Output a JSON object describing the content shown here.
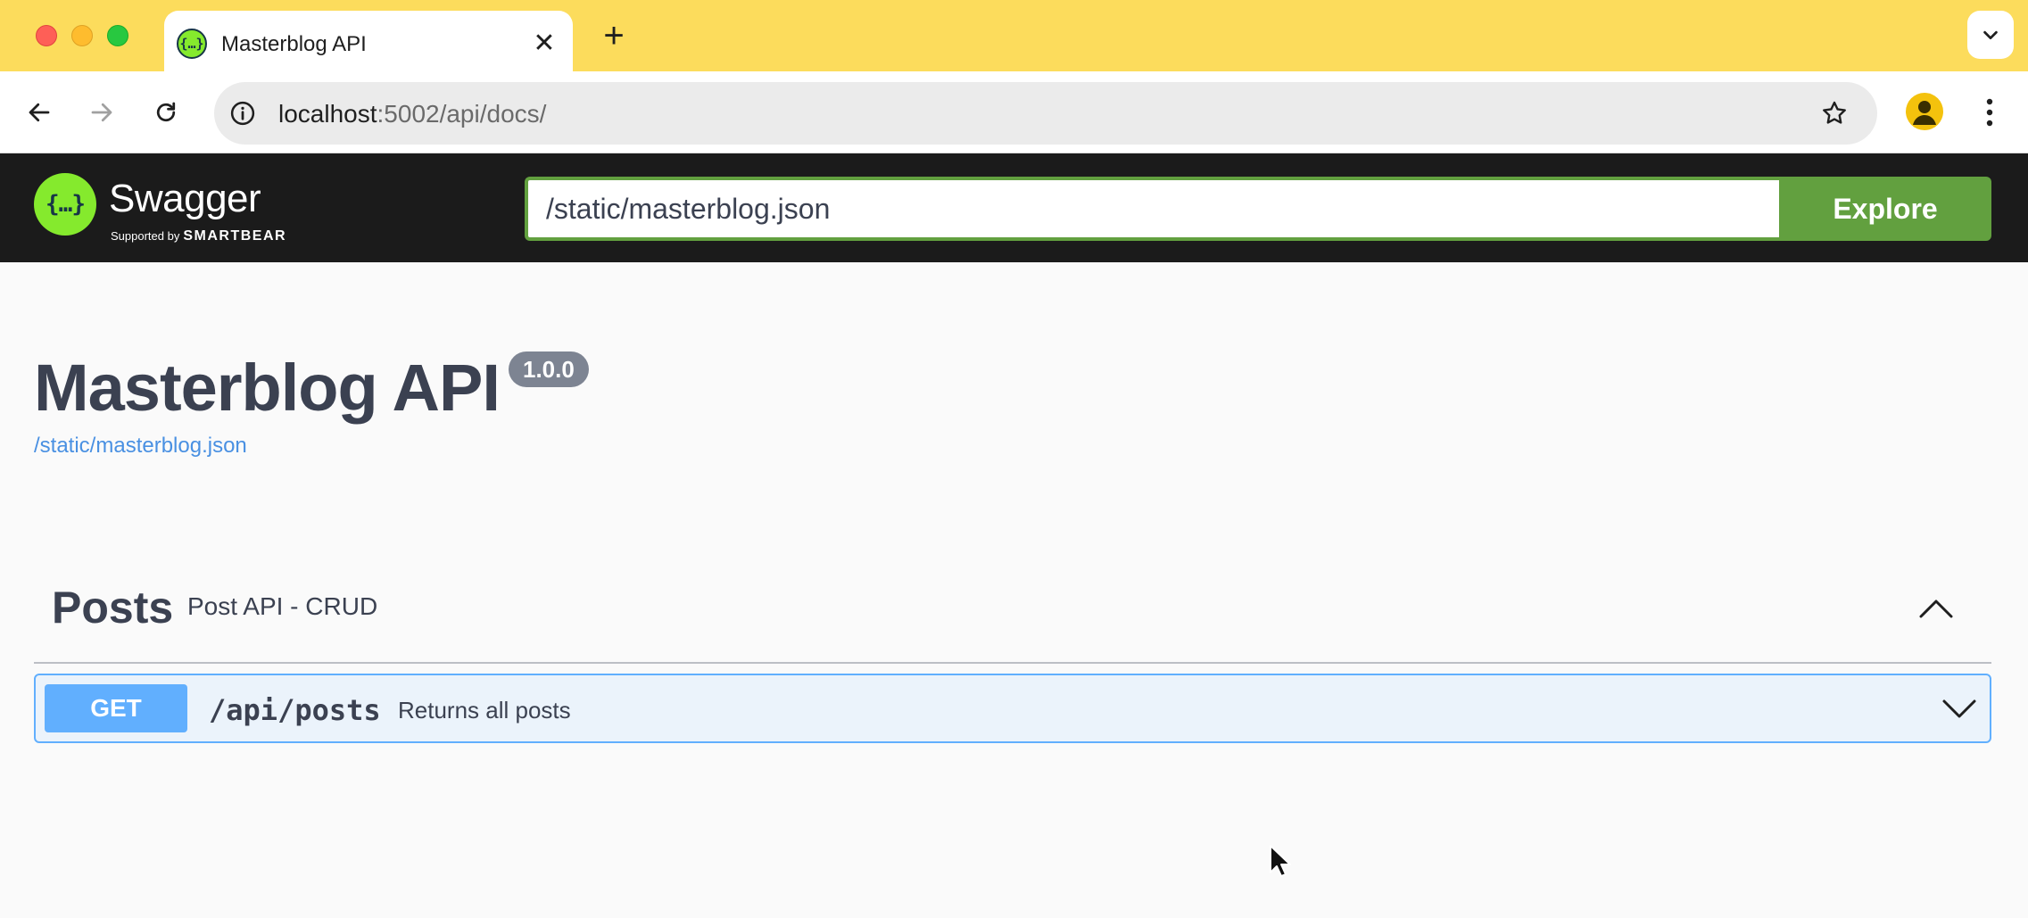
{
  "browser": {
    "tab": {
      "title": "Masterblog API",
      "favicon": "{…}"
    },
    "new_tab_glyph": "+",
    "close_glyph": "✕",
    "address": {
      "host": "localhost",
      "rest": ":5002/api/docs/"
    }
  },
  "swagger": {
    "logo_glyph": "{…}",
    "wordmark": "Swagger",
    "supported_by": "Supported by",
    "brand": "SMARTBEAR",
    "url_value": "/static/masterblog.json",
    "explore_label": "Explore"
  },
  "info": {
    "title": "Masterblog API",
    "version": "1.0.0",
    "spec_link": "/static/masterblog.json"
  },
  "tag": {
    "name": "Posts",
    "description": "Post API - CRUD"
  },
  "operations": [
    {
      "method": "GET",
      "path": "/api/posts",
      "summary": "Returns all posts"
    }
  ],
  "colors": {
    "tab_strip": "#fcdc5c",
    "swagger_green": "#62a03f",
    "get_blue": "#61affe",
    "text_dark": "#3b4151"
  }
}
